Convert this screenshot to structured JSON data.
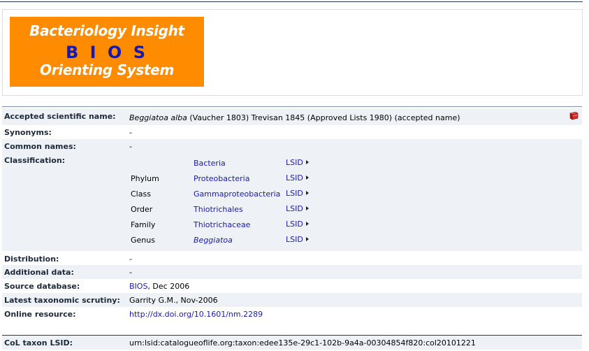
{
  "logo": {
    "line1": "Bacteriology Insight",
    "line2": "B I O S",
    "line3": "Orienting System",
    "bg_color": "#ff8c00",
    "mid_color": "#1a1aa8"
  },
  "accepted": {
    "label": "Accepted scientific name:",
    "genus_species": "Beggiatoa alba",
    "rest": " (Vaucher 1803) Trevisan 1845 (Approved Lists 1980) (accepted name)",
    "icon": "book-icon"
  },
  "synonyms": {
    "label": "Synonyms:",
    "value": "-"
  },
  "common_names": {
    "label": "Common names:",
    "value": "-"
  },
  "classification": {
    "label": "Classification:",
    "rows": [
      {
        "rank": "",
        "name": "Bacteria",
        "lsid": "LSID"
      },
      {
        "rank": "Phylum",
        "name": "Proteobacteria",
        "lsid": "LSID"
      },
      {
        "rank": "Class",
        "name": "Gammaproteobacteria",
        "lsid": "LSID"
      },
      {
        "rank": "Order",
        "name": "Thiotrichales",
        "lsid": "LSID"
      },
      {
        "rank": "Family",
        "name": "Thiotrichaceae",
        "lsid": "LSID"
      },
      {
        "rank": "Genus",
        "name": "Beggiatoa",
        "lsid": "LSID"
      }
    ]
  },
  "distribution": {
    "label": "Distribution:",
    "value": "-"
  },
  "additional": {
    "label": "Additional data:",
    "value": "-"
  },
  "source_db": {
    "label": "Source database:",
    "link": "BIOS",
    "rest": ", Dec 2006"
  },
  "scrutiny": {
    "label": "Latest taxonomic scrutiny:",
    "value": "Garrity G.M., Nov-2006"
  },
  "online": {
    "label": "Online resource:",
    "url": "http://dx.doi.org/10.1601/nm.2289"
  },
  "col_lsid": {
    "label": "CoL taxon LSID:",
    "value": "urn:lsid:catalogueoflife.org:taxon:edee135e-29c1-102b-9a4a-00304854f820:col20101221"
  }
}
